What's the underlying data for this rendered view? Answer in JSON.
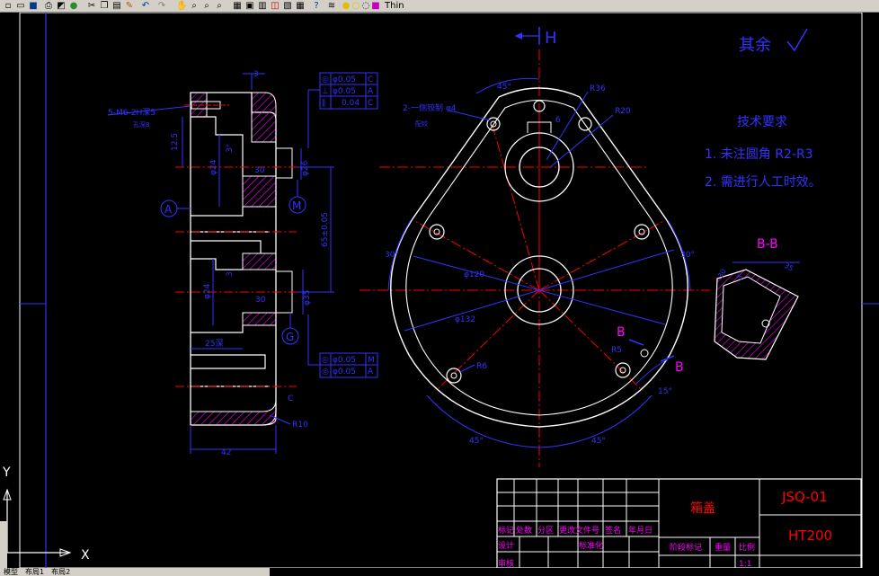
{
  "toolbar": {
    "linetype_label": "Thin",
    "icons": [
      "new-icon",
      "open-icon",
      "save-icon",
      "print-icon",
      "preview-icon",
      "publish-icon",
      "cut-icon",
      "copy-icon",
      "paste-icon",
      "match-icon",
      "undo-icon",
      "redo-icon",
      "pan-icon",
      "zoom-realtime-icon",
      "zoom-window-icon",
      "zoom-previous-icon",
      "properties-icon",
      "design-center-icon",
      "tool-palette-icon",
      "sheet-set-icon",
      "markup-icon",
      "calculator-icon",
      "help-icon",
      "layer-icon"
    ]
  },
  "drawing": {
    "roughness": "其余",
    "tech_title": "技术要求",
    "tech_1": "1. 未注圆角  R2-R3",
    "tech_2": "2. 需进行人工时效。",
    "view_h": "H",
    "section_bb": "B-B",
    "label_b1": "B",
    "label_b2": "B",
    "label_a": "A",
    "label_m": "M",
    "label_g": "G",
    "dim_thread": "5-M6-2H深5",
    "dim_thread2": "孔深8",
    "dim_125": "12.5",
    "dim_3": "3",
    "dim_30a": "3°",
    "dim_phi24a": "φ24",
    "dim_30b": "30",
    "dim_phi26": "φ26",
    "dim_65": "65±0.05",
    "dim_3b": "3",
    "dim_phi24b": "φ24",
    "dim_30c": "30",
    "dim_phi35": "φ35",
    "dim_25": "25深",
    "dim_42": "42",
    "dim_c": "C",
    "dim_r10": "R10",
    "dim_45a": "45°",
    "dim_r36": "R36",
    "dim_r20": "R20",
    "dim_phi4": "2-一侧铰制 φ4",
    "dim_phi4b": "配铰",
    "dim_6": "6",
    "dim_30l": "30°",
    "dim_30r": "30°",
    "dim_phi120": "φ120",
    "dim_phi132": "φ132",
    "dim_r5": "R5",
    "dim_r6": "R6",
    "dim_15": "15°",
    "dim_45b": "45°",
    "dim_45c": "45°",
    "dim_30s": "30",
    "dim_3s": "3",
    "dim_35s": "35",
    "tol1": {
      "a": "◎",
      "b": "φ0.05",
      "c": "C"
    },
    "tol2": {
      "a": "⊥",
      "b": "φ0.05",
      "c": "A"
    },
    "tol3": {
      "a": "∥",
      "b": "0.04",
      "c": "C"
    },
    "tol4": {
      "a": "◎",
      "b": "φ0.05",
      "c": "M"
    },
    "tol5": {
      "a": "◎",
      "b": "φ0.05",
      "c": "A"
    },
    "axis_x": "X",
    "axis_y": "Y"
  },
  "title_block": {
    "part_name": "箱盖",
    "drawing_no": "JSQ-01",
    "material": "HT200",
    "row_labels": [
      "标记",
      "处数",
      "分区",
      "更改文件号",
      "签名",
      "年月日"
    ],
    "design": "设计",
    "standard": "标准化",
    "stage": "阶段标记",
    "weight": "重量",
    "scale": "比例",
    "scale_val": "1:1",
    "review": "审核"
  },
  "tabs": [
    "模型",
    "布局1",
    "布局2"
  ],
  "colors": {
    "outline": "#ffffff",
    "centerline": "#ff0000",
    "dimension": "#3232ff",
    "hatch": "#ff00ff",
    "border": "#ffffff"
  }
}
